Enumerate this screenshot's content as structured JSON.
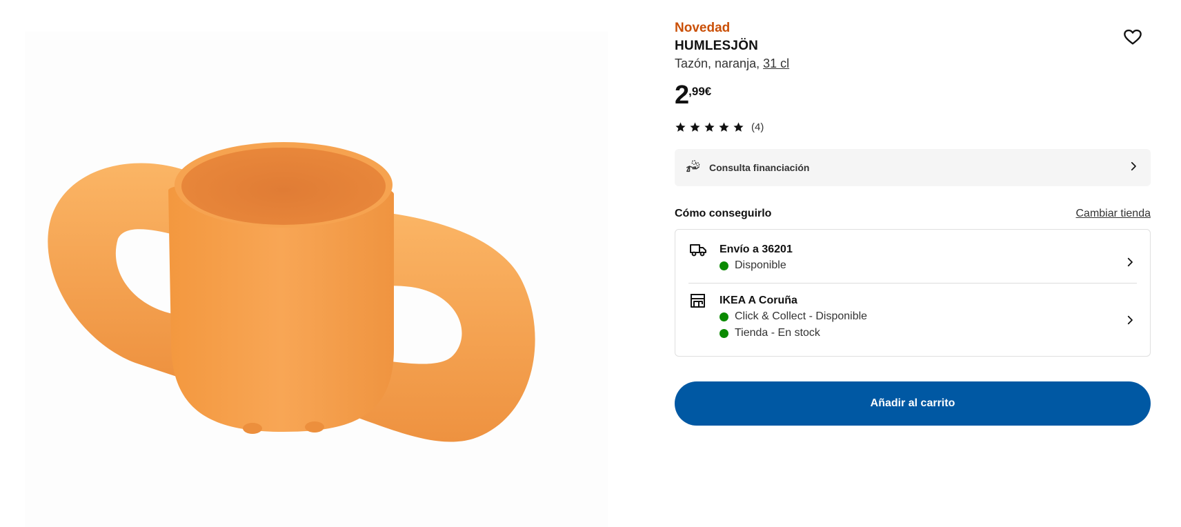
{
  "product": {
    "badge": "Novedad",
    "name": "HUMLESJÖN",
    "description": "Tazón, naranja, ",
    "measure": "31 cl",
    "price_int": "2",
    "price_dec": ",99€",
    "rating": 5,
    "rating_count": "(4)",
    "image_icon": "orange-mug-with-two-handles"
  },
  "finance": {
    "label": "Consulta financiación",
    "icon": "financing-hand-icon"
  },
  "availability": {
    "title": "Cómo conseguirlo",
    "change_store": "Cambiar tienda",
    "delivery": {
      "head": "Envío a 36201",
      "status": "Disponible"
    },
    "store": {
      "head": "IKEA A Coruña",
      "status1": "Click & Collect - Disponible",
      "status2": "Tienda - En stock"
    },
    "status_color": "#0a8a00"
  },
  "cart": {
    "label": "Añadir al carrito",
    "color": "#0058a3"
  },
  "colors": {
    "badge": "#ca5008",
    "mug": "#f7a450"
  }
}
